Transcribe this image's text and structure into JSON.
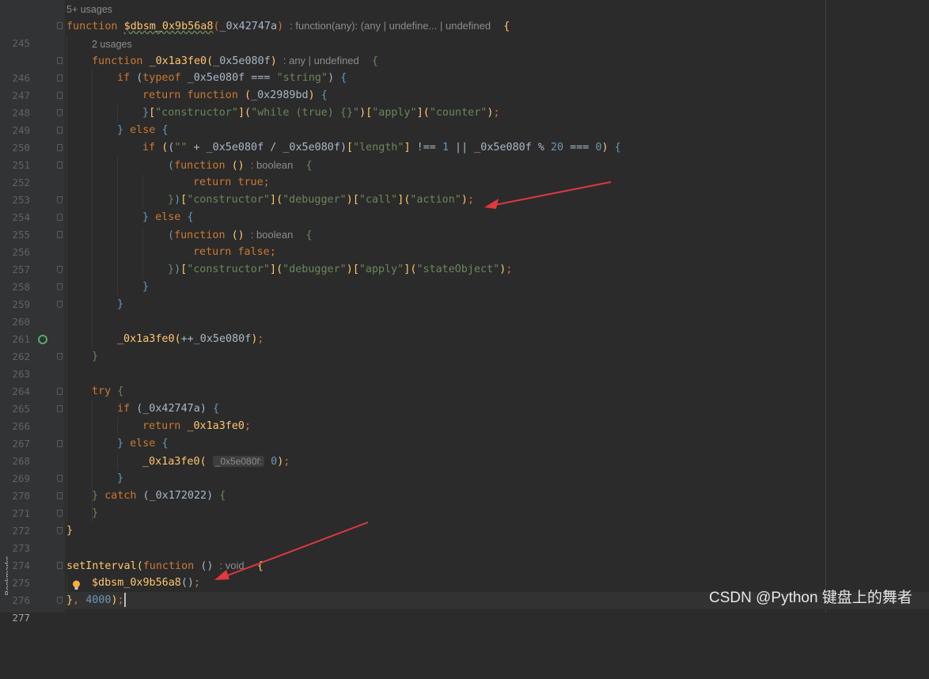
{
  "sidebar": {
    "bookmarks_label": "Bookmarks"
  },
  "editor": {
    "current_line": "277",
    "usages_top": "5+ usages",
    "usages_inner": "2 usages",
    "lines": [
      {
        "n": "245"
      },
      {
        "n": "246"
      },
      {
        "n": "247"
      },
      {
        "n": "248"
      },
      {
        "n": "249"
      },
      {
        "n": "250"
      },
      {
        "n": "251"
      },
      {
        "n": "252"
      },
      {
        "n": "253"
      },
      {
        "n": "254"
      },
      {
        "n": "255"
      },
      {
        "n": "256"
      },
      {
        "n": "257"
      },
      {
        "n": "258"
      },
      {
        "n": "259"
      },
      {
        "n": "260"
      },
      {
        "n": "261"
      },
      {
        "n": "262"
      },
      {
        "n": "263"
      },
      {
        "n": "264"
      },
      {
        "n": "265"
      },
      {
        "n": "266"
      },
      {
        "n": "267"
      },
      {
        "n": "268"
      },
      {
        "n": "269"
      },
      {
        "n": "270"
      },
      {
        "n": "271"
      },
      {
        "n": "272"
      },
      {
        "n": "273"
      },
      {
        "n": "274"
      },
      {
        "n": "275"
      },
      {
        "n": "276"
      },
      {
        "n": "277"
      }
    ],
    "hints": {
      "outer_sig": ": function(any): (any | undefine... | undefined",
      "inner_sig": ": any | undefined",
      "bool": ": boolean",
      "param": "_0x5e080f:",
      "void": ": void"
    },
    "tokens": {
      "function": "function",
      "return": "return",
      "if": "if",
      "else": "else",
      "try": "try",
      "catch": "catch",
      "typeof": "typeof",
      "true": "true",
      "false": "false",
      "outer_fn": "$dbsm_0x9b56a8",
      "outer_param": "_0x42747a",
      "inner_fn": "_0x1a3fe0",
      "inner_param": "_0x5e080f",
      "anon_param": "_0x2989bd",
      "catch_param": "_0x172022",
      "set_interval": "setInterval",
      "s_string": "\"string\"",
      "s_constructor": "\"constructor\"",
      "s_while": "\"while (true) {}\"",
      "s_apply": "\"apply\"",
      "s_counter": "\"counter\"",
      "s_empty": "\"\"",
      "s_length": "\"length\"",
      "s_debugger": "\"debugger\"",
      "s_call": "\"call\"",
      "s_action": "\"action\"",
      "s_state": "\"stateObject\"",
      "n1": "1",
      "n20": "20",
      "n0": "0",
      "n4000": "4000"
    }
  },
  "watermark": "CSDN @Python  键盘上的舞者",
  "colors": {
    "background": "#2b2b2b",
    "keyword": "#cc7832",
    "function_name": "#ffc66d",
    "string": "#6a8759",
    "number": "#6897bb",
    "arrow": "#e0393e"
  }
}
